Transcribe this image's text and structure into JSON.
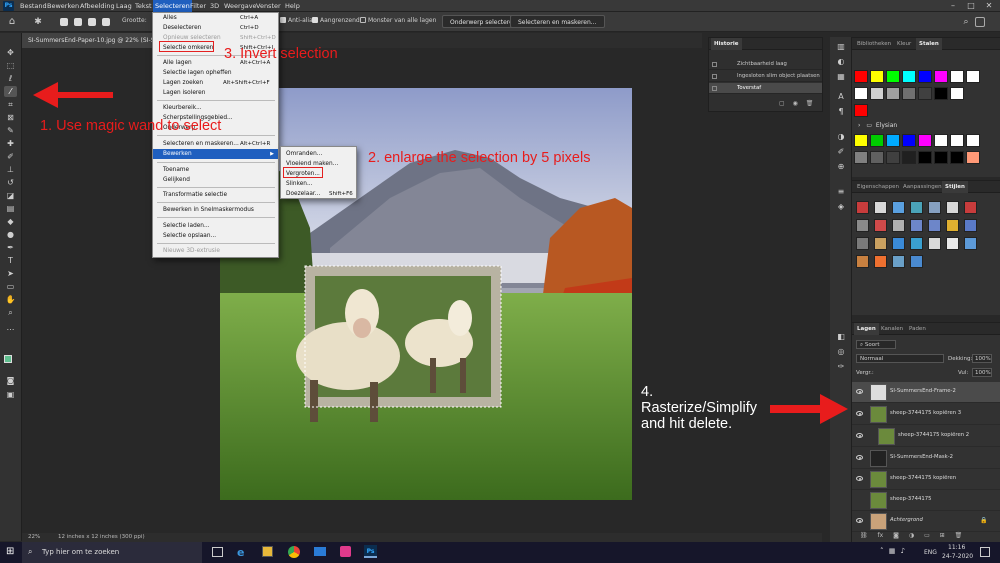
{
  "app": {
    "logo": "Ps"
  },
  "menubar": {
    "items": [
      "Bestand",
      "Bewerken",
      "Afbeelding",
      "Laag",
      "Tekst",
      "Selecteren",
      "Filter",
      "3D",
      "Weergave",
      "Venster",
      "Help"
    ],
    "active": "Selecteren"
  },
  "optionsbar": {
    "size_label": "Grootte:",
    "sample_all": "Alle lagen",
    "anti_alias": "Anti-alias",
    "contiguous": "Aangrenzend",
    "sample_all_layers": "Monster van alle lagen",
    "subject_button": "Onderwerp selecteren",
    "select_mask_button": "Selecteren en maskeren..."
  },
  "document_tab": {
    "title": "SI-SummersEnd-Paper-10.jpg @ 22% (SI-Summe"
  },
  "select_menu": {
    "items": [
      {
        "label": "Alles",
        "shortcut": "Ctrl+A"
      },
      {
        "label": "Deselecteren",
        "shortcut": "Ctrl+D"
      },
      {
        "label": "Opnieuw selecteren",
        "shortcut": "Shift+Ctrl+D",
        "disabled": true
      },
      {
        "label": "Selectie omkeren",
        "shortcut": "Shift+Ctrl+I"
      },
      {
        "label": "Alle lagen",
        "shortcut": "Alt+Ctrl+A"
      },
      {
        "label": "Selectie lagen opheffen",
        "shortcut": ""
      },
      {
        "label": "Lagen zoeken",
        "shortcut": "Alt+Shift+Ctrl+F"
      },
      {
        "label": "Lagen isoleren",
        "shortcut": ""
      },
      {
        "label": "Kleurbereik...",
        "shortcut": ""
      },
      {
        "label": "Scherpstellingsgebied...",
        "shortcut": ""
      },
      {
        "label": "Onderwerp",
        "shortcut": ""
      },
      {
        "label": "Selecteren en maskeren...",
        "shortcut": "Alt+Ctrl+R"
      },
      {
        "label": "Bewerken",
        "shortcut": ""
      },
      {
        "label": "Toename",
        "shortcut": ""
      },
      {
        "label": "Gelijkend",
        "shortcut": ""
      },
      {
        "label": "Transformatie selectie",
        "shortcut": ""
      },
      {
        "label": "Bewerken in Snelmaskermodus",
        "shortcut": ""
      },
      {
        "label": "Selectie laden...",
        "shortcut": ""
      },
      {
        "label": "Selectie opslaan...",
        "shortcut": ""
      },
      {
        "label": "Nieuwe 3D-extrusie",
        "shortcut": "",
        "disabled": true
      }
    ]
  },
  "modify_submenu": {
    "items": [
      {
        "label": "Omranden...",
        "shortcut": ""
      },
      {
        "label": "Vloeiend maken...",
        "shortcut": ""
      },
      {
        "label": "Vergroten...",
        "shortcut": ""
      },
      {
        "label": "Slinken...",
        "shortcut": ""
      },
      {
        "label": "Doezelaar...",
        "shortcut": "Shift+F6"
      }
    ]
  },
  "annotations": {
    "step1": "1. Use magic wand to select",
    "step2": "2. enlarge the selection by 5 pixels",
    "step3": "3. Invert selection",
    "step4": "4. Rasterize/Simplify and hit delete."
  },
  "history_panel": {
    "tab": "Historie",
    "rows": [
      "Zichtbaarheid laag",
      "Ingesloten slim object plaatsen",
      "Toverstaf"
    ]
  },
  "swatches_panel": {
    "tabs": [
      "Bibliotheken",
      "Kleur",
      "Stalen"
    ],
    "group_name": "Elysian",
    "row1": [
      "#ff0000",
      "#ffff00",
      "#00ff00",
      "#00ffff",
      "#0000ff",
      "#ff00ff",
      "#ffffff",
      "#ffffff"
    ],
    "row2": [
      "#ffffff",
      "#d0d0d0",
      "#a0a0a0",
      "#707070",
      "#404040",
      "#000000",
      "#ffffff"
    ],
    "row3": [
      "#ff0000"
    ],
    "row4": [
      "#ffff00",
      "#00cc00",
      "#00aaff",
      "#0000ff",
      "#ff00ff",
      "#ffffff",
      "#ffffff",
      "#ffffff"
    ],
    "row5": [
      "#808080",
      "#606060",
      "#404040",
      "#202020",
      "#000000",
      "#000000",
      "#000000",
      "#ff9977"
    ]
  },
  "styles_panel": {
    "tabs": [
      "Eigenschappen",
      "Aanpassingen",
      "Stijlen"
    ]
  },
  "layers_panel": {
    "tabs": [
      "Lagen",
      "Kanalen",
      "Paden"
    ],
    "filter": "Soort",
    "blend_mode": "Normaal",
    "opacity_label": "Dekking:",
    "opacity_value": "100%",
    "lock_label": "Vergr.:",
    "fill_label": "Vul:",
    "fill_value": "100%",
    "layers": [
      {
        "name": "SI-SummersEnd-Frame-2",
        "selected": true
      },
      {
        "name": "sheep-3744175 kopiëren 3"
      },
      {
        "name": "sheep-3744175 kopiëren 2"
      },
      {
        "name": "SI-SummersEnd-Mask-2"
      },
      {
        "name": "sheep-3744175 kopiëren"
      },
      {
        "name": "sheep-3744175"
      },
      {
        "name": "Achtergrond"
      }
    ]
  },
  "statusbar": {
    "zoom": "22%",
    "doc_info": "12 inches x 12 inches (300 ppi)"
  },
  "taskbar": {
    "search_placeholder": "Typ hier om te zoeken",
    "language": "ENG",
    "time": "11:16",
    "date": "24-7-2020"
  }
}
